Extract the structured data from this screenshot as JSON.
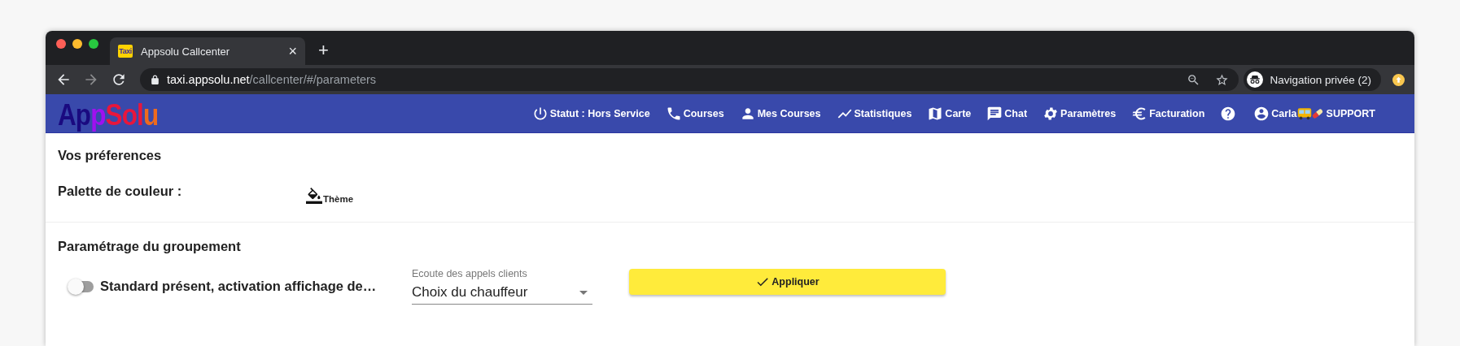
{
  "browser": {
    "tab": {
      "favicon_text": "Taxi",
      "title": "Appsolu Callcenter",
      "close": "×",
      "selected": true
    },
    "new_tab": "+",
    "url": {
      "domain": "taxi.appsolu.net",
      "path": "/callcenter/#/parameters"
    },
    "profile": "Navigation privée (2)"
  },
  "logo": [
    {
      "text": "Ap",
      "color": "#1a0a80"
    },
    {
      "text": "p",
      "color": "#a010f0"
    },
    {
      "text": "Sol",
      "color": "#e8163c"
    },
    {
      "text": "u",
      "color": "#ee6a1e"
    }
  ],
  "nav": [
    {
      "kind": "link",
      "label": "Statut : Hors Service"
    },
    {
      "kind": "link",
      "label": "Courses"
    },
    {
      "kind": "link",
      "label": "Mes Courses"
    },
    {
      "kind": "link",
      "label": "Statistiques"
    },
    {
      "kind": "link",
      "label": "Carte"
    },
    {
      "kind": "link",
      "label": "Chat"
    },
    {
      "kind": "link",
      "label": "Paramètres"
    },
    {
      "kind": "link",
      "label": "Facturation"
    },
    {
      "kind": "iconbutton"
    },
    {
      "kind": "user",
      "label": "Carla"
    }
  ],
  "user_role": "SUPPORT",
  "preferences": {
    "title": "Vos préferences",
    "palette_label": "Palette de couleur :",
    "theme_button": "Thème"
  },
  "group": {
    "title": "Paramétrage du groupement",
    "toggle": {
      "label": "Standard présent, activation affichage de…",
      "checked": false
    },
    "select": {
      "label": "Ecoute des appels clients",
      "value": "Choix du chauffeur"
    },
    "apply_button": "Appliquer"
  }
}
